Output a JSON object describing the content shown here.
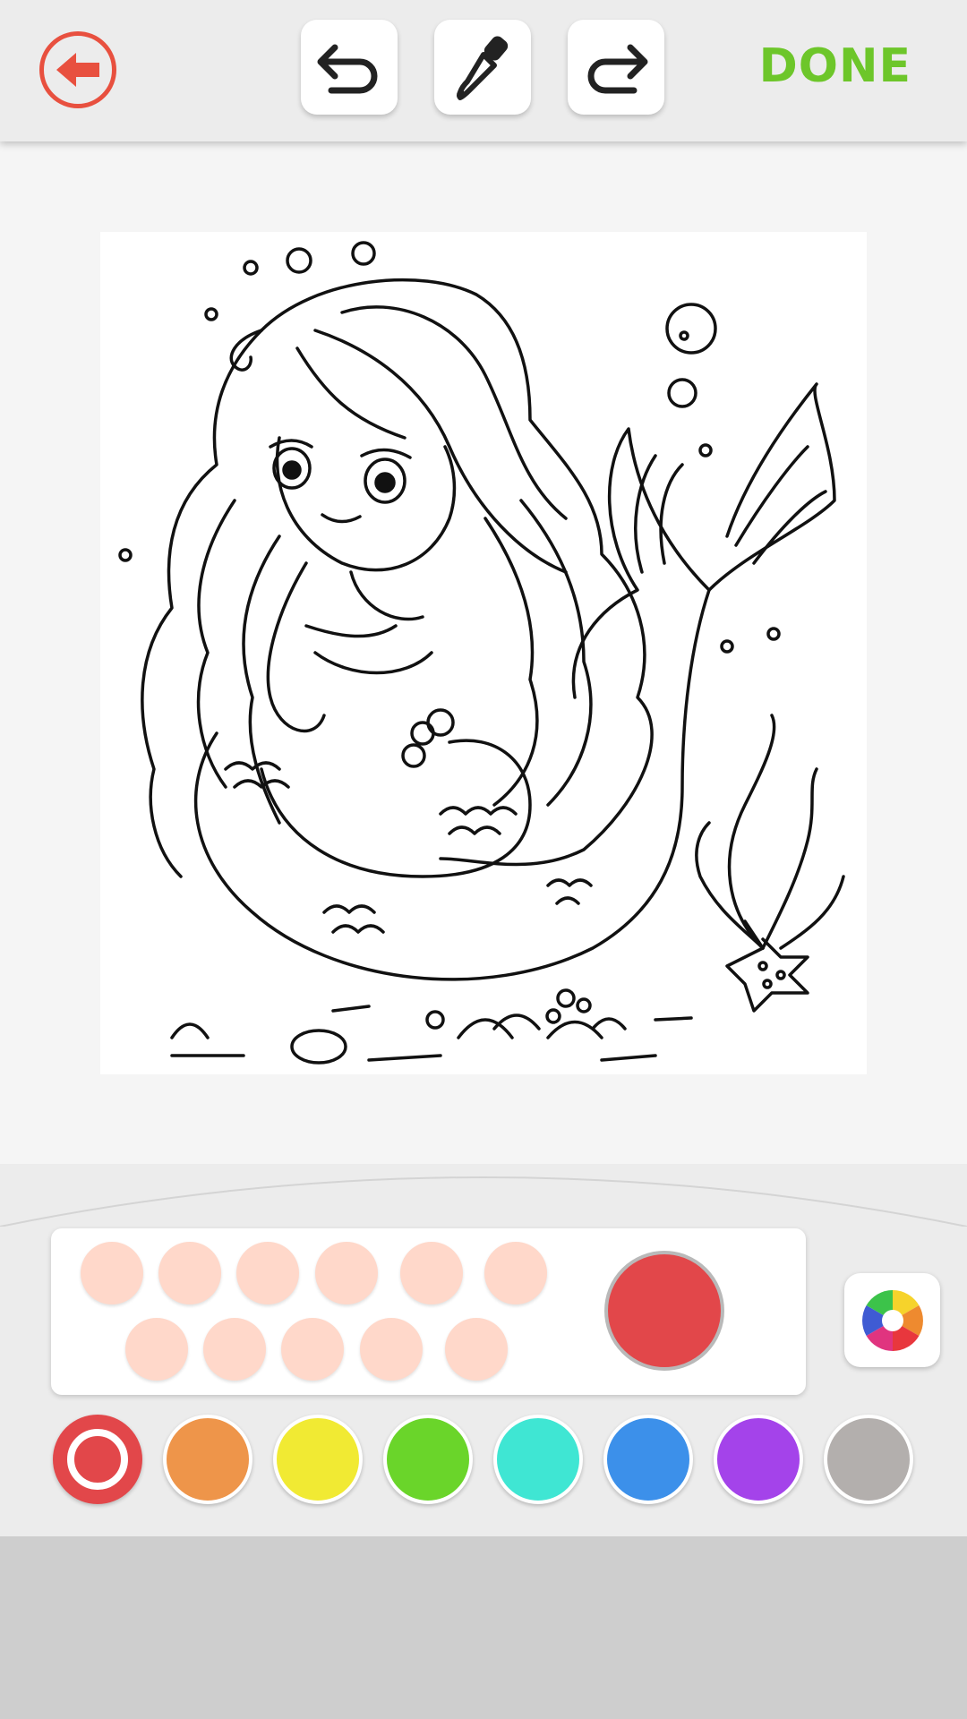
{
  "toolbar": {
    "back_icon": "arrow-left-icon",
    "undo_icon": "undo-icon",
    "eyedropper_icon": "eyedropper-icon",
    "redo_icon": "redo-icon",
    "done_label": "DONE"
  },
  "colors": {
    "accent_back": "#e8503f",
    "done": "#6dc62a",
    "skin_tone": "#ffd8ca",
    "current_color": "#e2474a"
  },
  "recent_swatches": [
    "#ffd8ca",
    "#ffd8ca",
    "#ffd8ca",
    "#ffd8ca",
    "#ffd8ca",
    "#ffd8ca",
    "#ffd8ca",
    "#ffd8ca",
    "#ffd8ca",
    "#ffd8ca",
    "#ffd8ca"
  ],
  "palette": [
    {
      "name": "red",
      "hex": "#e2474a",
      "selected": true
    },
    {
      "name": "orange",
      "hex": "#ee954a",
      "selected": false
    },
    {
      "name": "yellow",
      "hex": "#f1ea33",
      "selected": false
    },
    {
      "name": "green",
      "hex": "#6ad52a",
      "selected": false
    },
    {
      "name": "turquoise",
      "hex": "#3fe6d3",
      "selected": false
    },
    {
      "name": "blue",
      "hex": "#3c90ea",
      "selected": false
    },
    {
      "name": "purple",
      "hex": "#a443ea",
      "selected": false
    },
    {
      "name": "gray",
      "hex": "#b3afad",
      "selected": false
    }
  ],
  "color_wheel_icon": "color-wheel-icon",
  "canvas_image": "mermaid-coloring-page"
}
